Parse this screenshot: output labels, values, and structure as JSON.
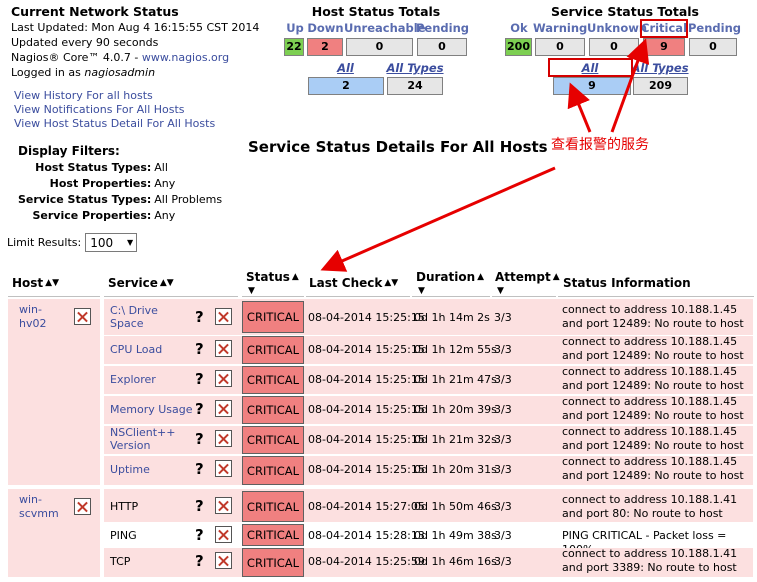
{
  "header": {
    "title": "Current Network Status",
    "last_updated": "Last Updated: Mon Aug 4 16:15:55 CST 2014",
    "update_freq": "Updated every 90 seconds",
    "version_prefix": "Nagios® Core™ 4.0.7 - ",
    "version_link": "www.nagios.org",
    "logged_prefix": "Logged in as ",
    "logged_user": "nagiosadmin"
  },
  "links": [
    "View History For all hosts",
    "View Notifications For All Hosts",
    "View Host Status Detail For All Hosts"
  ],
  "filters": {
    "title": "Display Filters:",
    "items": [
      {
        "k": "Host Status Types:",
        "v": "All"
      },
      {
        "k": "Host Properties:",
        "v": "Any"
      },
      {
        "k": "Service Status Types:",
        "v": "All Problems"
      },
      {
        "k": "Service Properties:",
        "v": "Any"
      }
    ]
  },
  "limit": {
    "label": "Limit Results:",
    "value": "100"
  },
  "host_totals": {
    "title": "Host Status Totals",
    "headers": [
      "Up",
      "Down",
      "Unreachable",
      "Pending"
    ],
    "values": [
      "22",
      "2",
      "0",
      "0"
    ],
    "problems_label": "All Problems",
    "types_label": "All Types",
    "problems": "2",
    "types": "24"
  },
  "service_totals": {
    "title": "Service Status Totals",
    "headers": [
      "Ok",
      "Warning",
      "Unknown",
      "Critical",
      "Pending"
    ],
    "values": [
      "200",
      "0",
      "0",
      "9",
      "0"
    ],
    "problems_label": "All Problems",
    "types_label": "All Types",
    "problems": "9",
    "types": "209"
  },
  "main_title": "Service Status Details For All Hosts",
  "annotation": "查看报警的服务",
  "columns": [
    "Host",
    "Service",
    "Status",
    "Last Check",
    "Duration",
    "Attempt",
    "Status Information"
  ],
  "hosts": [
    "win-hv02",
    "win-scvmm"
  ],
  "rows": [
    {
      "service": "C:\\ Drive Space",
      "status": "CRITICAL",
      "last_check": "08-04-2014 15:25:15",
      "duration": "0d 1h 14m 2s",
      "attempt": "3/3",
      "info": "connect to address 10.188.1.45 and port 12489: No route to host"
    },
    {
      "service": "CPU Load",
      "status": "CRITICAL",
      "last_check": "08-04-2014 15:25:15",
      "duration": "0d 1h 12m 55s",
      "attempt": "3/3",
      "info": "connect to address 10.188.1.45 and port 12489: No route to host"
    },
    {
      "service": "Explorer",
      "status": "CRITICAL",
      "last_check": "08-04-2014 15:25:15",
      "duration": "0d 1h 21m 47s",
      "attempt": "3/3",
      "info": "connect to address 10.188.1.45 and port 12489: No route to host"
    },
    {
      "service": "Memory Usage",
      "status": "CRITICAL",
      "last_check": "08-04-2014 15:25:15",
      "duration": "0d 1h 20m 39s",
      "attempt": "3/3",
      "info": "connect to address 10.188.1.45 and port 12489: No route to host"
    },
    {
      "service": "NSClient++ Version",
      "status": "CRITICAL",
      "last_check": "08-04-2014 15:25:15",
      "duration": "0d 1h 21m 32s",
      "attempt": "3/3",
      "info": "connect to address 10.188.1.45 and port 12489: No route to host"
    },
    {
      "service": "Uptime",
      "status": "CRITICAL",
      "last_check": "08-04-2014 15:25:15",
      "duration": "0d 1h 20m 31s",
      "attempt": "3/3",
      "info": "connect to address 10.188.1.45 and port 12489: No route to host"
    },
    {
      "service": "HTTP",
      "status": "CRITICAL",
      "last_check": "08-04-2014 15:27:05",
      "duration": "0d 1h 50m 46s",
      "attempt": "3/3",
      "info": "connect to address 10.188.1.41 and port 80: No route to host"
    },
    {
      "service": "PING",
      "status": "CRITICAL",
      "last_check": "08-04-2014 15:28:13",
      "duration": "0d 1h 49m 38s",
      "attempt": "3/3",
      "info": "PING CRITICAL - Packet loss = 100%"
    },
    {
      "service": "TCP",
      "status": "CRITICAL",
      "last_check": "08-04-2014 15:25:59",
      "duration": "0d 1h 46m 16s",
      "attempt": "3/3",
      "info": "connect to address 10.188.1.41 and port 3389: No route to host"
    }
  ],
  "colors": {
    "critical": "#f08080",
    "ok": "#7dcf52",
    "row": "#fce0e0",
    "link": "#3b4d9e",
    "annotation": "#e60000"
  }
}
